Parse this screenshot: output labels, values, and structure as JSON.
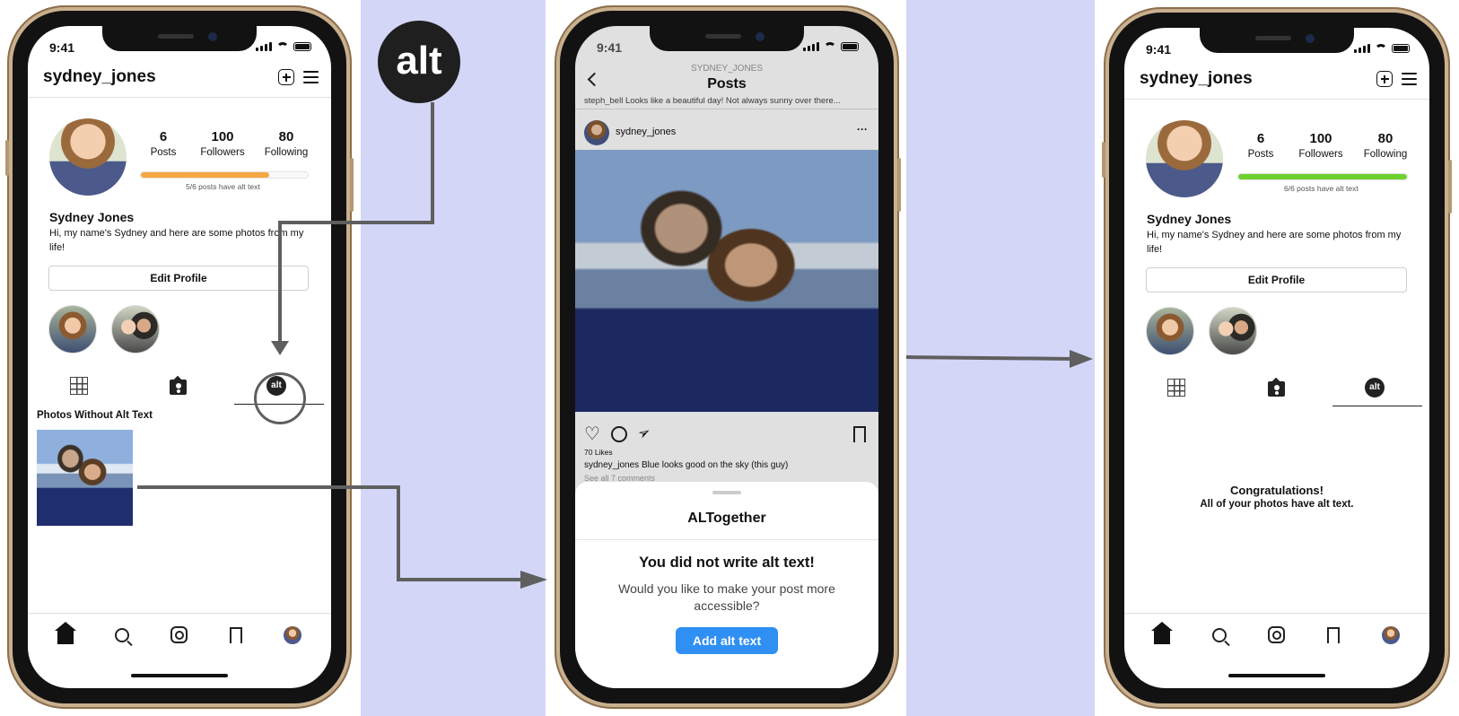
{
  "profile": {
    "username": "sydney_jones",
    "stats": [
      {
        "value": "6",
        "label": "Posts"
      },
      {
        "value": "100",
        "label": "Followers"
      },
      {
        "value": "80",
        "label": "Following"
      }
    ],
    "name": "Sydney Jones",
    "bio": "Hi, my name's Sydney and here are some photos from my life!",
    "edit_button": "Edit Profile"
  },
  "screen1": {
    "time": "9:41",
    "progress_caption": "5/6 posts have alt text",
    "progress_fraction": 0.77,
    "progress_color": "#f5a742",
    "section_title": "Photos Without Alt Text",
    "alt_tab_label": "alt"
  },
  "alt_badge": "alt",
  "screen2": {
    "time": "9:41",
    "header_sub": "SYDNEY_JONES",
    "header_title": "Posts",
    "prev_caption": "steph_bell Looks like a beautiful day! Not always sunny over there...",
    "post_user": "sydney_jones",
    "more": "···",
    "likes": "70 Likes",
    "caption_user": "sydney_jones",
    "caption_text": "Blue looks good on the sky (this guy)",
    "comments": "See all 7 comments",
    "sheet": {
      "title": "ALTogether",
      "heading": "You did not write alt text!",
      "body": "Would you like to make your post more accessible?",
      "button": "Add alt text",
      "button_color": "#2f8ff2"
    }
  },
  "screen3": {
    "time": "9:41",
    "progress_caption": "6/6 posts have alt text",
    "progress_fraction": 1.0,
    "progress_color": "#6fd12f",
    "alt_tab_label": "alt",
    "congrats_title": "Congratulations!",
    "congrats_body": "All of your photos have alt text."
  },
  "colors": {
    "background_band": "#d4d6f8",
    "arrow": "#5f5f5f"
  }
}
